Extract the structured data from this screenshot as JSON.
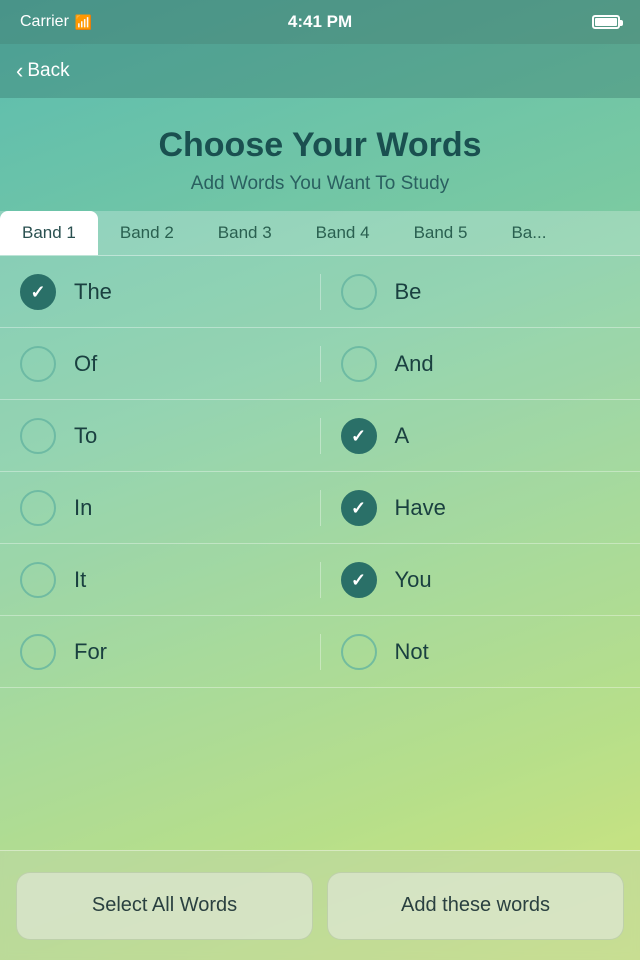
{
  "statusBar": {
    "carrier": "Carrier",
    "time": "4:41 PM"
  },
  "nav": {
    "backLabel": "Back"
  },
  "header": {
    "title": "Choose Your Words",
    "subtitle": "Add Words You Want To Study"
  },
  "tabs": [
    {
      "label": "Band 1",
      "active": true
    },
    {
      "label": "Band 2",
      "active": false
    },
    {
      "label": "Band 3",
      "active": false
    },
    {
      "label": "Band 4",
      "active": false
    },
    {
      "label": "Band 5",
      "active": false
    },
    {
      "label": "Ba...",
      "active": false
    }
  ],
  "words": [
    {
      "left": {
        "text": "The",
        "checked": true
      },
      "right": {
        "text": "Be",
        "checked": false
      }
    },
    {
      "left": {
        "text": "Of",
        "checked": false
      },
      "right": {
        "text": "And",
        "checked": false
      }
    },
    {
      "left": {
        "text": "To",
        "checked": false
      },
      "right": {
        "text": "A",
        "checked": true
      }
    },
    {
      "left": {
        "text": "In",
        "checked": false
      },
      "right": {
        "text": "Have",
        "checked": true
      }
    },
    {
      "left": {
        "text": "It",
        "checked": false
      },
      "right": {
        "text": "You",
        "checked": true
      }
    },
    {
      "left": {
        "text": "For",
        "checked": false
      },
      "right": {
        "text": "Not",
        "checked": false
      }
    }
  ],
  "buttons": {
    "selectAll": "Select All Words",
    "addWords": "Add these words"
  }
}
